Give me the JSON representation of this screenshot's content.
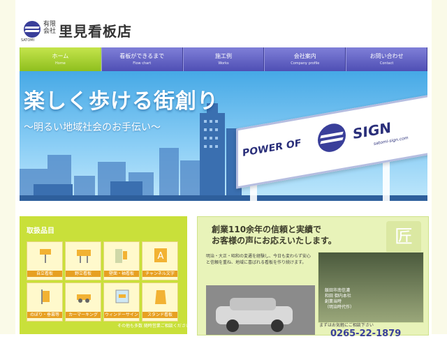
{
  "header": {
    "logo_sub": "SATOMI",
    "company_type": "有限会社",
    "company_name": "里見看板店"
  },
  "nav": [
    {
      "label": "ホーム",
      "sub": "Home",
      "active": true
    },
    {
      "label": "看板ができるまで",
      "sub": "Flow chart",
      "active": false
    },
    {
      "label": "施工例",
      "sub": "Works",
      "active": false
    },
    {
      "label": "会社案内",
      "sub": "Company profile",
      "active": false
    },
    {
      "label": "お問い合わせ",
      "sub": "Contact",
      "active": false
    }
  ],
  "hero": {
    "title": "楽しく歩ける街創り",
    "subtitle": "～明るい地域社会のお手伝い～",
    "billboard_left": "POWER OF",
    "billboard_right": "SIGN",
    "billboard_url": "satomi-sign.com"
  },
  "products": {
    "title": "取扱品目",
    "items": [
      {
        "label": "自立看板",
        "icon": "stand-sign-icon"
      },
      {
        "label": "野立看板",
        "icon": "roadside-sign-icon"
      },
      {
        "label": "壁面・袖看板",
        "icon": "wall-sign-icon"
      },
      {
        "label": "チャンネル文字",
        "icon": "channel-letter-icon"
      },
      {
        "label": "のぼり・垂幕等",
        "icon": "banner-icon"
      },
      {
        "label": "カーマーキング",
        "icon": "car-marking-icon"
      },
      {
        "label": "ウィンドーサイン",
        "icon": "window-sign-icon"
      },
      {
        "label": "スタンド看板",
        "icon": "stand-board-icon"
      }
    ],
    "footer": "その他も多数 随時営業ご相談ください"
  },
  "story": {
    "headline_line1": "創業110余年の信頼と実績で",
    "headline_line2": "お客様の声にお応えいたします。",
    "body": "明治・大正・昭和の変遷を経験し、今日も変わらず安心と信頼を重ね、地域に喜ばれる看板を作り続けます。",
    "caption": "飯田市南信濃\n和田 御内本社\n創業当時\n（明治時代作）",
    "footer": "まずはお気軽にご相談下さい",
    "phone": "0265-22-1879",
    "hanko": "匠"
  }
}
